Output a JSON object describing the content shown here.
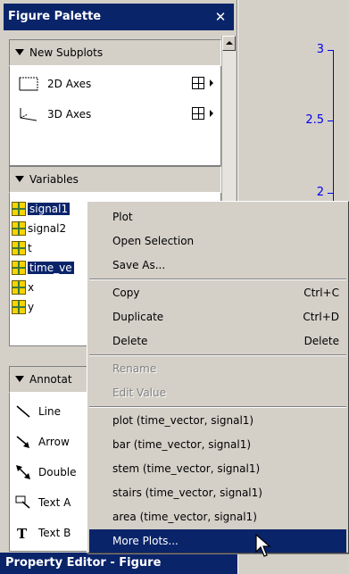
{
  "palette": {
    "title": "Figure Palette",
    "close": "✕",
    "new_subplots": {
      "header": "New Subplots",
      "items": [
        {
          "label": "2D Axes",
          "icon": "2d-axes-icon"
        },
        {
          "label": "3D Axes",
          "icon": "3d-axes-icon"
        }
      ]
    },
    "variables": {
      "header": "Variables",
      "items": [
        {
          "label": "signal1",
          "selected": true
        },
        {
          "label": "signal2",
          "selected": false
        },
        {
          "label": "t",
          "selected": false
        },
        {
          "label": "time_ve",
          "selected": true
        },
        {
          "label": "x",
          "selected": false
        },
        {
          "label": "y",
          "selected": false
        }
      ]
    },
    "annotations": {
      "header": "Annotat",
      "items": [
        {
          "label": "Line",
          "icon": "line-icon"
        },
        {
          "label": "Arrow",
          "icon": "arrow-icon"
        },
        {
          "label": "Double",
          "icon": "double-arrow-icon"
        },
        {
          "label": "Text A",
          "icon": "text-arrow-icon"
        },
        {
          "label": "Text B",
          "icon": "text-box-icon"
        }
      ]
    }
  },
  "property_editor": {
    "title": "Property Editor - Figure"
  },
  "axes": {
    "tick_labels": [
      "3",
      "2.5",
      "2"
    ]
  },
  "context_menu": {
    "items": [
      {
        "label": "Plot",
        "shortcut": "",
        "disabled": false
      },
      {
        "label": "Open Selection",
        "shortcut": "",
        "disabled": false
      },
      {
        "label": "Save As...",
        "shortcut": "",
        "disabled": false
      },
      {
        "label": "Copy",
        "shortcut": "Ctrl+C",
        "disabled": false
      },
      {
        "label": "Duplicate",
        "shortcut": "Ctrl+D",
        "disabled": false
      },
      {
        "label": "Delete",
        "shortcut": "Delete",
        "disabled": false
      },
      {
        "label": "Rename",
        "shortcut": "",
        "disabled": true
      },
      {
        "label": "Edit Value",
        "shortcut": "",
        "disabled": true
      },
      {
        "label": "plot (time_vector, signal1)",
        "shortcut": "",
        "disabled": false
      },
      {
        "label": "bar (time_vector, signal1)",
        "shortcut": "",
        "disabled": false
      },
      {
        "label": "stem (time_vector, signal1)",
        "shortcut": "",
        "disabled": false
      },
      {
        "label": "stairs (time_vector, signal1)",
        "shortcut": "",
        "disabled": false
      },
      {
        "label": "area (time_vector, signal1)",
        "shortcut": "",
        "disabled": false
      },
      {
        "label": "More Plots...",
        "shortcut": "",
        "disabled": false,
        "highlighted": true
      }
    ]
  },
  "colors": {
    "title_bar": "#0a246a",
    "axis": "#0000ee",
    "panel": "#d4d0c8"
  }
}
